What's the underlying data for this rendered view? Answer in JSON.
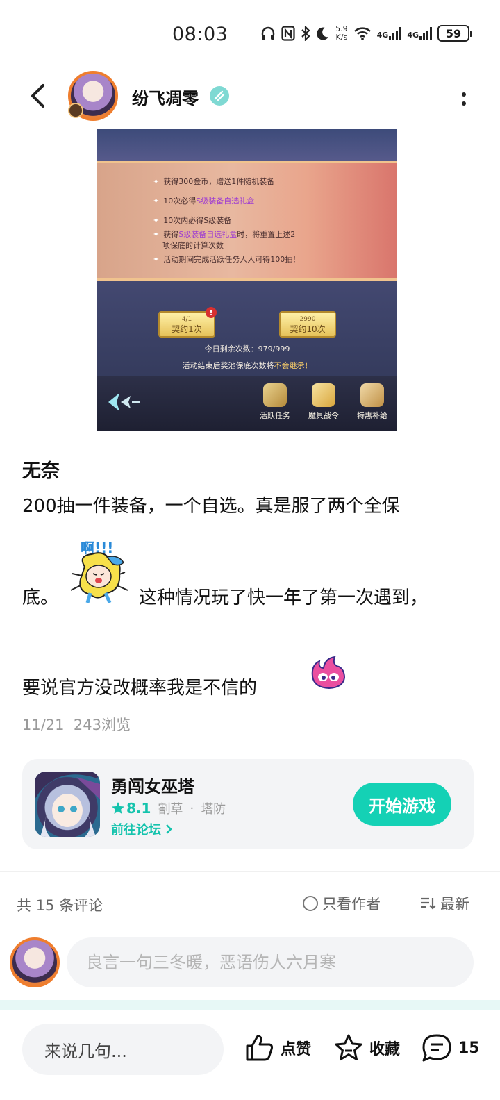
{
  "status_bar": {
    "time": "08:03",
    "net_speed_value": "5.9",
    "net_speed_unit": "K/s",
    "signal1": "4G",
    "signal2": "4G",
    "battery": "59"
  },
  "header": {
    "author_name": "纷飞凋零"
  },
  "post_image": {
    "lines": [
      {
        "prefix": "获得300金币，赠送1件随机装备",
        "highlight": "",
        "suffix": ""
      },
      {
        "prefix": "10次必得",
        "highlight": "S级装备自选礼盒",
        "suffix": ""
      },
      {
        "prefix": "10次内必得S级装备",
        "highlight": "",
        "suffix": ""
      },
      {
        "prefix": "获得",
        "highlight": "S级装备自选礼盒",
        "suffix": "时，将重置上述2"
      },
      {
        "prefix": "项保底的计算次数",
        "highlight": "",
        "suffix": ""
      },
      {
        "prefix": "活动期间完成活跃任务人人可得100抽！",
        "highlight": "",
        "suffix": ""
      }
    ],
    "btn1_cost": "4/1",
    "btn1_label": "契约1次",
    "btn2_cost": "2990",
    "btn2_label": "契约10次",
    "red_dot": "!",
    "remaining": "今日剩余次数：979/999",
    "warn_prefix": "活动结束后奖池保底次数将",
    "warn_highlight": "不会继承！",
    "menu": [
      "活跃任务",
      "魔具战令",
      "特惠补给"
    ]
  },
  "post": {
    "title": "无奈",
    "line1": "200抽一件装备，一个自选。真是服了两个全保",
    "line2_start": "底。",
    "line2_end": "这种情况玩了快一年了第一次遇到，",
    "line3": "要说官方没改概率我是不信的",
    "sticker_text": "啊!!!",
    "date": "11/21",
    "views": "243浏览"
  },
  "game_card": {
    "name": "勇闯女巫塔",
    "rating": "8.1",
    "tag1": "割草",
    "tag_sep": "·",
    "tag2": "塔防",
    "forum_link": "前往论坛",
    "play_button": "开始游戏"
  },
  "comments": {
    "count_label": "共 15 条评论",
    "only_author": "只看作者",
    "sort": "最新",
    "input_placeholder": "良言一句三冬暖，恶语伤人六月寒"
  },
  "bottom_bar": {
    "input_placeholder": "来说几句...",
    "like_label": "点赞",
    "favorite_label": "收藏",
    "comment_count": "15"
  },
  "colors": {
    "accent": "#14d1b5",
    "accent_text": "#14c3ad",
    "card_bg": "#f3f4f6",
    "avatar_ring": "#ef7e2e"
  }
}
